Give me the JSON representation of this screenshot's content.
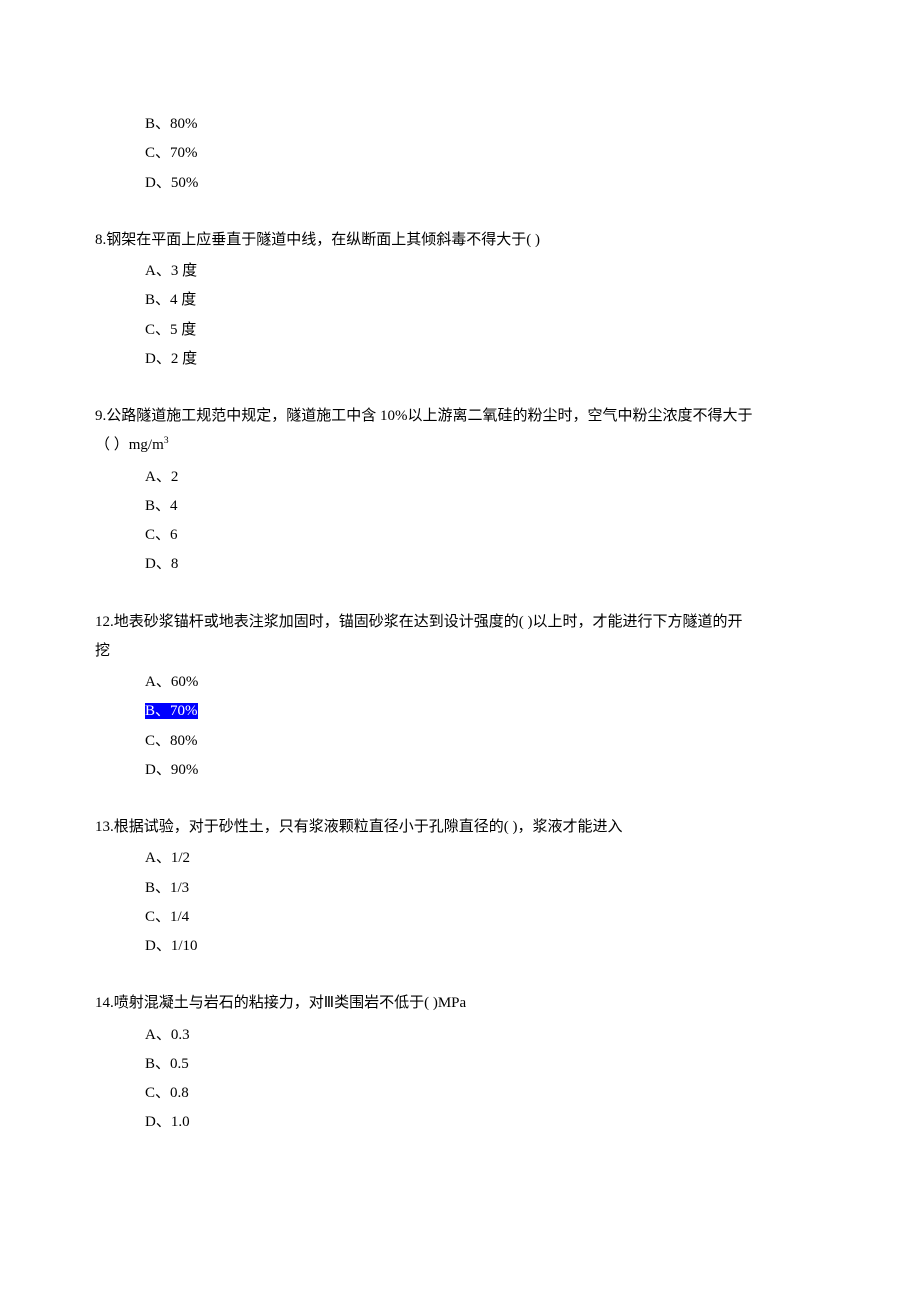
{
  "orphan_options": {
    "b": "B、80%",
    "c": "C、70%",
    "d": "D、50%"
  },
  "q8": {
    "text": "8.钢架在平面上应垂直于隧道中线，在纵断面上其倾斜毒不得大于(  )",
    "a": "A、3 度",
    "b": "B、4 度",
    "c": "C、5 度",
    "d": "D、2 度"
  },
  "q9": {
    "text_part1": "9.公路隧道施工规范中规定，隧道施工中含 10%以上游离二氧硅的粉尘时，空气中粉尘浓度不得大于",
    "text_part2": "（  ）mg/m",
    "text_sup": "3",
    "a": "A、2",
    "b": "B、4",
    "c": "C、6",
    "d": "D、8"
  },
  "q12": {
    "text_part1": "12.地表砂浆锚杆或地表注浆加固时，锚固砂浆在达到设计强度的(  )以上时，才能进行下方隧道的开",
    "text_part2": "挖",
    "a": "A、60%",
    "b": "B、70%",
    "c": "C、80%",
    "d": "D、90%"
  },
  "q13": {
    "text": "13.根据试验，对于砂性土，只有浆液颗粒直径小于孔隙直径的(  )，浆液才能进入",
    "a": "A、1/2",
    "b": "B、1/3",
    "c": "C、1/4",
    "d": "D、1/10"
  },
  "q14": {
    "text": "14.喷射混凝土与岩石的粘接力，对Ⅲ类围岩不低于(  )MPa",
    "a": "A、0.3",
    "b": "B、0.5",
    "c": "C、0.8",
    "d": "D、1.0"
  }
}
